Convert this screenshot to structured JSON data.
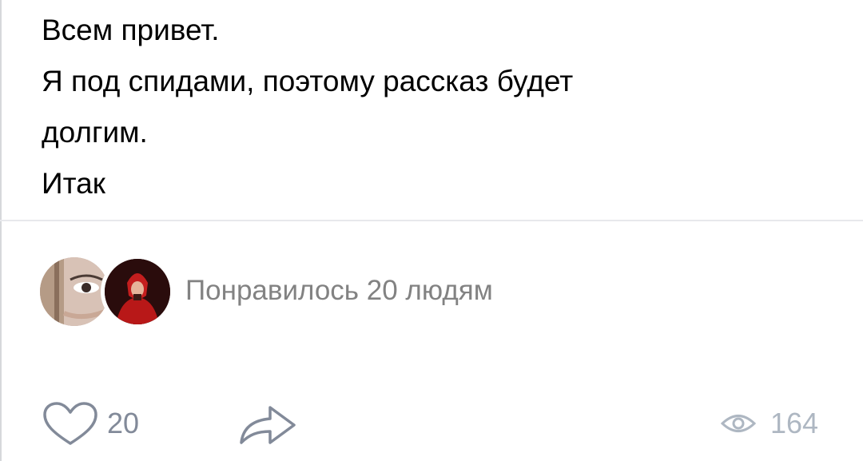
{
  "post": {
    "lines": [
      "Всем привет.",
      "Я под спидами, поэтому рассказ будет",
      "долгим.",
      "Итак"
    ]
  },
  "likes_summary": {
    "text": "Понравилось 20 людям"
  },
  "actions": {
    "like_count": "20",
    "like_icon": "heart-outline",
    "share_icon": "share-arrow",
    "views_icon": "eye",
    "views_count": "164"
  },
  "colors": {
    "text": "#000000",
    "secondary": "#828282",
    "icon": "#828a99",
    "views": "#aeb7c2"
  }
}
